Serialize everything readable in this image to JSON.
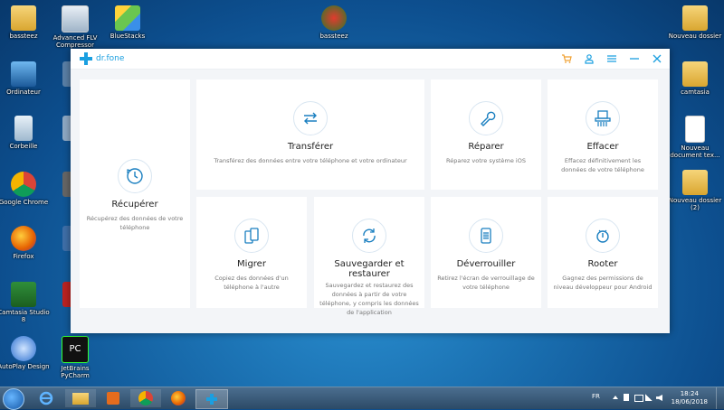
{
  "desktop": {
    "icons": [
      {
        "label": "bassteez"
      },
      {
        "label": "Advanced FLV Compressor"
      },
      {
        "label": "BlueStacks"
      },
      {
        "label": "bassteez"
      },
      {
        "label": "Nouveau dossier"
      },
      {
        "label": "Ordinateur"
      },
      {
        "label": "Corbeille"
      },
      {
        "label": "Google Chrome"
      },
      {
        "label": "Firefox"
      },
      {
        "label": "Camtasia Studio 8"
      },
      {
        "label": "AutoPlay Design"
      },
      {
        "label": "JetBrains PyCharm"
      },
      {
        "label": "camtasia"
      },
      {
        "label": "Nouveau document tex..."
      },
      {
        "label": "Nouveau dossier (2)"
      }
    ]
  },
  "window": {
    "app_name": "dr.fone",
    "cards": [
      {
        "title": "Récupérer",
        "desc": "Récupérez des données de votre téléphone"
      },
      {
        "title": "Transférer",
        "desc": "Transférez des données entre votre téléphone et votre ordinateur"
      },
      {
        "title": "Réparer",
        "desc": "Réparez votre système iOS"
      },
      {
        "title": "Effacer",
        "desc": "Effacez définitivement les données de votre téléphone"
      },
      {
        "title": "Migrer",
        "desc": "Copiez des données d'un téléphone à l'autre"
      },
      {
        "title": "Sauvegarder et restaurer",
        "desc": "Sauvegardez et restaurez des données à partir de votre téléphone, y compris les données de l'application"
      },
      {
        "title": "Déverrouiller",
        "desc": "Retirez l'écran de verrouillage de votre téléphone"
      },
      {
        "title": "Rooter",
        "desc": "Gagnez des permissions de niveau développeur pour Android"
      }
    ]
  },
  "taskbar": {
    "language": "FR",
    "time": "18:24",
    "date": "18/06/2018"
  },
  "colors": {
    "accent": "#1a9fe0",
    "cart": "#f0a030"
  }
}
